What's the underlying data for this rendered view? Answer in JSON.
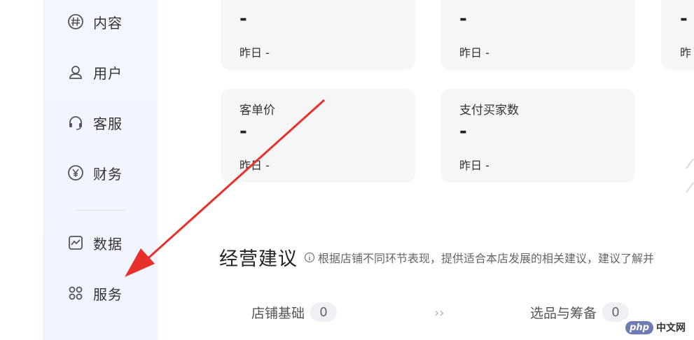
{
  "sidebar": {
    "items": [
      {
        "label": "内容",
        "icon": "hash-circle-icon"
      },
      {
        "label": "用户",
        "icon": "user-icon"
      },
      {
        "label": "客服",
        "icon": "headset-icon"
      },
      {
        "label": "财务",
        "icon": "yuan-circle-icon"
      },
      {
        "label": "数据",
        "icon": "chart-icon"
      },
      {
        "label": "服务",
        "icon": "grid-four-icon"
      }
    ]
  },
  "cards": [
    {
      "title": "",
      "value": "-",
      "yesterday": "昨日 -"
    },
    {
      "title": "",
      "value": "-",
      "yesterday": "昨日 -"
    },
    {
      "title": "",
      "value": "-",
      "yesterday": "昨"
    },
    {
      "title": "客单价",
      "value": "-",
      "yesterday": "昨日 -"
    },
    {
      "title": "支付买家数",
      "value": "-",
      "yesterday": "昨日 -"
    }
  ],
  "section": {
    "title": "经营建议",
    "description": "根据店铺不同环节表现，提供适合本店发展的相关建议，建议了解并"
  },
  "steps": [
    {
      "label": "店铺基础",
      "count": "0"
    },
    {
      "label": "选品与筹备",
      "count": "0"
    }
  ],
  "step_arrow": "››",
  "watermark": {
    "php": "php",
    "site": "中文网"
  },
  "colors": {
    "annotation_red": "#e8302a",
    "sidebar_bg": "#f2f5ff",
    "card_bg": "#f5f6f8"
  }
}
